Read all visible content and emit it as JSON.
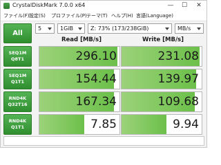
{
  "window": {
    "title": "CrystalDiskMark 7.0.0 x64",
    "controls": {
      "minimize": "—",
      "maximize": "☐",
      "close": "✕"
    }
  },
  "menu": [
    "ファイル(F)",
    "設定(S)",
    "プロファイル(P)",
    "テーマ(T)",
    "ヘルプ(H)",
    "言語(Language)"
  ],
  "controls": {
    "all_label": "All",
    "count": "5",
    "size": "1GiB",
    "drive": "Z: 73% (173/238GiB)",
    "unit": "MB/s"
  },
  "headers": {
    "read": "Read [MB/s]",
    "write": "Write [MB/s]"
  },
  "tests": [
    {
      "line1": "SEQ1M",
      "line2": "Q8T1",
      "read": "296.10",
      "write": "231.08",
      "read_fill": 0.97,
      "write_fill": 0.97
    },
    {
      "line1": "SEQ1M",
      "line2": "Q1T1",
      "read": "154.44",
      "write": "139.97",
      "read_fill": 0.93,
      "write_fill": 0.93
    },
    {
      "line1": "RND4K",
      "line2": "Q32T16",
      "read": "167.34",
      "write": "109.68",
      "read_fill": 0.93,
      "write_fill": 0.91
    },
    {
      "line1": "RND4K",
      "line2": "Q1T1",
      "read": "7.85",
      "write": "9.94",
      "read_fill": 0.56,
      "write_fill": 0.56
    }
  ],
  "colors": {
    "accent": "#3a9a3a",
    "bar": "#6cc04a"
  }
}
